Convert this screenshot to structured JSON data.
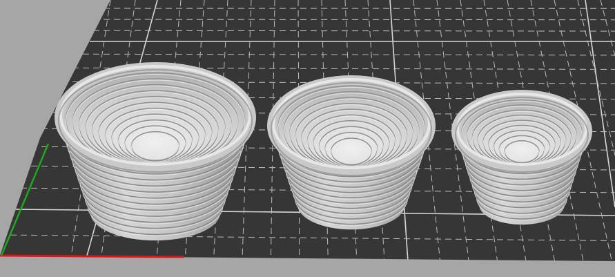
{
  "viewport": {
    "background_color": "#a6a6a6",
    "plate_color": "#363636",
    "grid_major_color": "#d8d8d8",
    "grid_minor_color": "#bdbdbd",
    "axis_x_color": "#d41a1a",
    "axis_y_color": "#1fa81f",
    "model_color": "#c9c9c9"
  },
  "objects": [
    {
      "name": "large-spiral-bowl",
      "rings": 11
    },
    {
      "name": "medium-spiral-bowl",
      "rings": 10
    },
    {
      "name": "small-spiral-bowl",
      "rings": 9
    }
  ]
}
